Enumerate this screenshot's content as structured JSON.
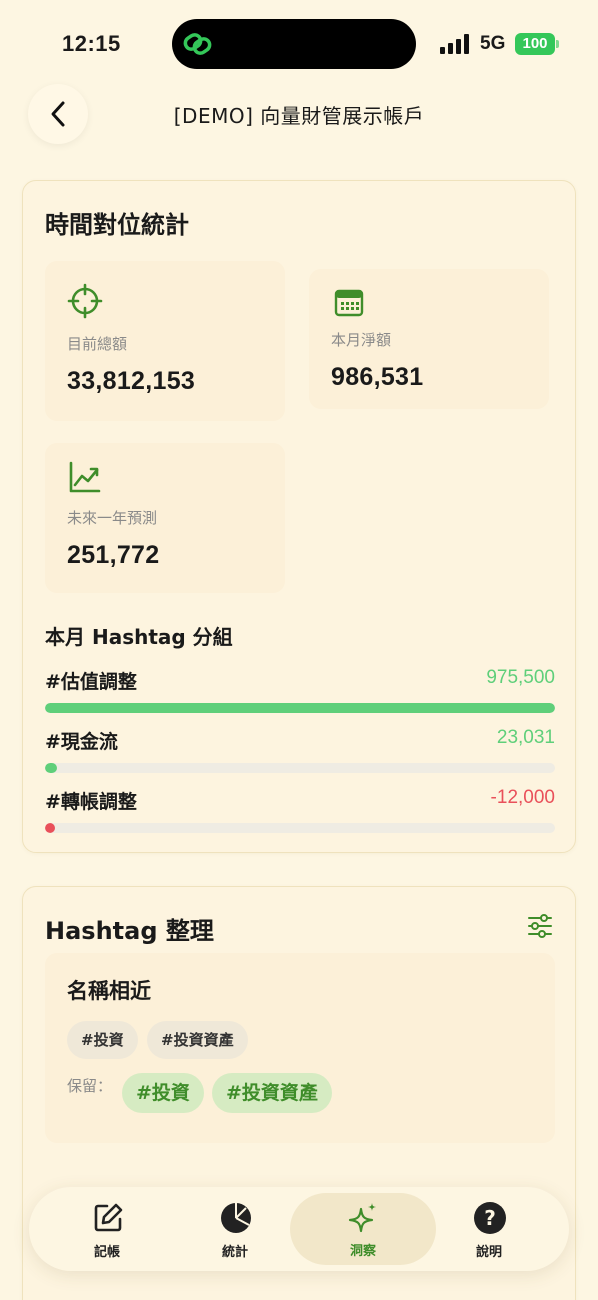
{
  "status_bar": {
    "time": "12:15",
    "network": "5G",
    "battery": "100"
  },
  "header": {
    "title": "[DEMO] 向量財管展示帳戶"
  },
  "time_stats": {
    "title": "時間對位統計",
    "current_total": {
      "label": "目前總額",
      "value": "33,812,153",
      "icon": "crosshair-icon"
    },
    "month_net": {
      "label": "本月淨額",
      "value": "986,531",
      "icon": "calendar-icon"
    },
    "forecast": {
      "label": "未來一年預測",
      "value": "251,772",
      "icon": "trend-up-icon"
    }
  },
  "hashtag_groups": {
    "title": "本月 Hashtag 分組",
    "items": [
      {
        "name": "#估值調整",
        "value": "975,500",
        "fraction": 1.0,
        "color": "#5fcf7a"
      },
      {
        "name": "#現金流",
        "value": "23,031",
        "fraction": 0.024,
        "color": "#5fcf7a"
      },
      {
        "name": "#轉帳調整",
        "value": "-12,000",
        "fraction": 0.012,
        "color": "#e9505a"
      }
    ],
    "positive_color": "#5fcf7a",
    "negative_color": "#e9505a"
  },
  "hashtag_cleanup": {
    "title": "Hashtag 整理",
    "similar": {
      "title": "名稱相近",
      "tags": [
        "#投資",
        "#投資資產"
      ],
      "keep_label": "保留：",
      "keep_tags": [
        "#投資",
        "#投資資產"
      ]
    }
  },
  "tabs": [
    {
      "label": "記帳",
      "icon": "edit-icon"
    },
    {
      "label": "統計",
      "icon": "pie-chart-icon"
    },
    {
      "label": "洞察",
      "icon": "sparkle-icon",
      "active": true
    },
    {
      "label": "說明",
      "icon": "help-icon"
    }
  ],
  "accent_color": "#3f8d2a"
}
